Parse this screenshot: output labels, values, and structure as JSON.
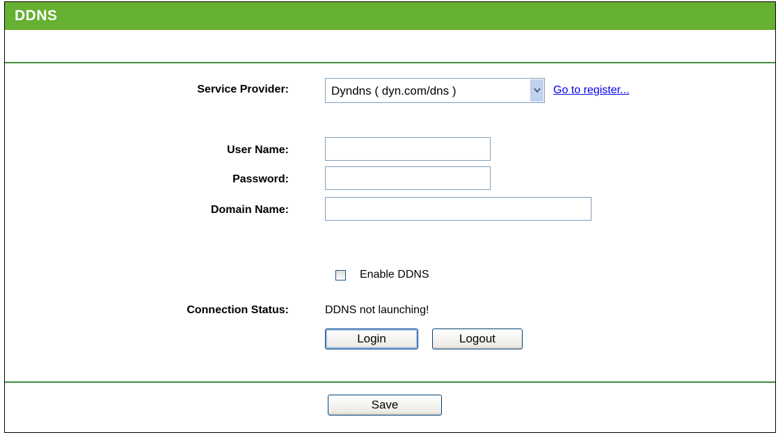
{
  "header": {
    "title": "DDNS"
  },
  "form": {
    "service_provider": {
      "label": "Service Provider:",
      "selected": "Dyndns ( dyn.com/dns )",
      "link": "Go to register..."
    },
    "username": {
      "label": "User Name:",
      "value": ""
    },
    "password": {
      "label": "Password:",
      "value": ""
    },
    "domain": {
      "label": "Domain Name:",
      "value": ""
    },
    "enable": {
      "label": "Enable DDNS",
      "checked": false
    },
    "status": {
      "label": "Connection Status:",
      "value": "DDNS not launching!"
    },
    "login_label": "Login",
    "logout_label": "Logout"
  },
  "footer": {
    "save_label": "Save"
  },
  "colors": {
    "header": "#66b032",
    "divider": "#3d8b3d",
    "link": "#0000ee"
  }
}
